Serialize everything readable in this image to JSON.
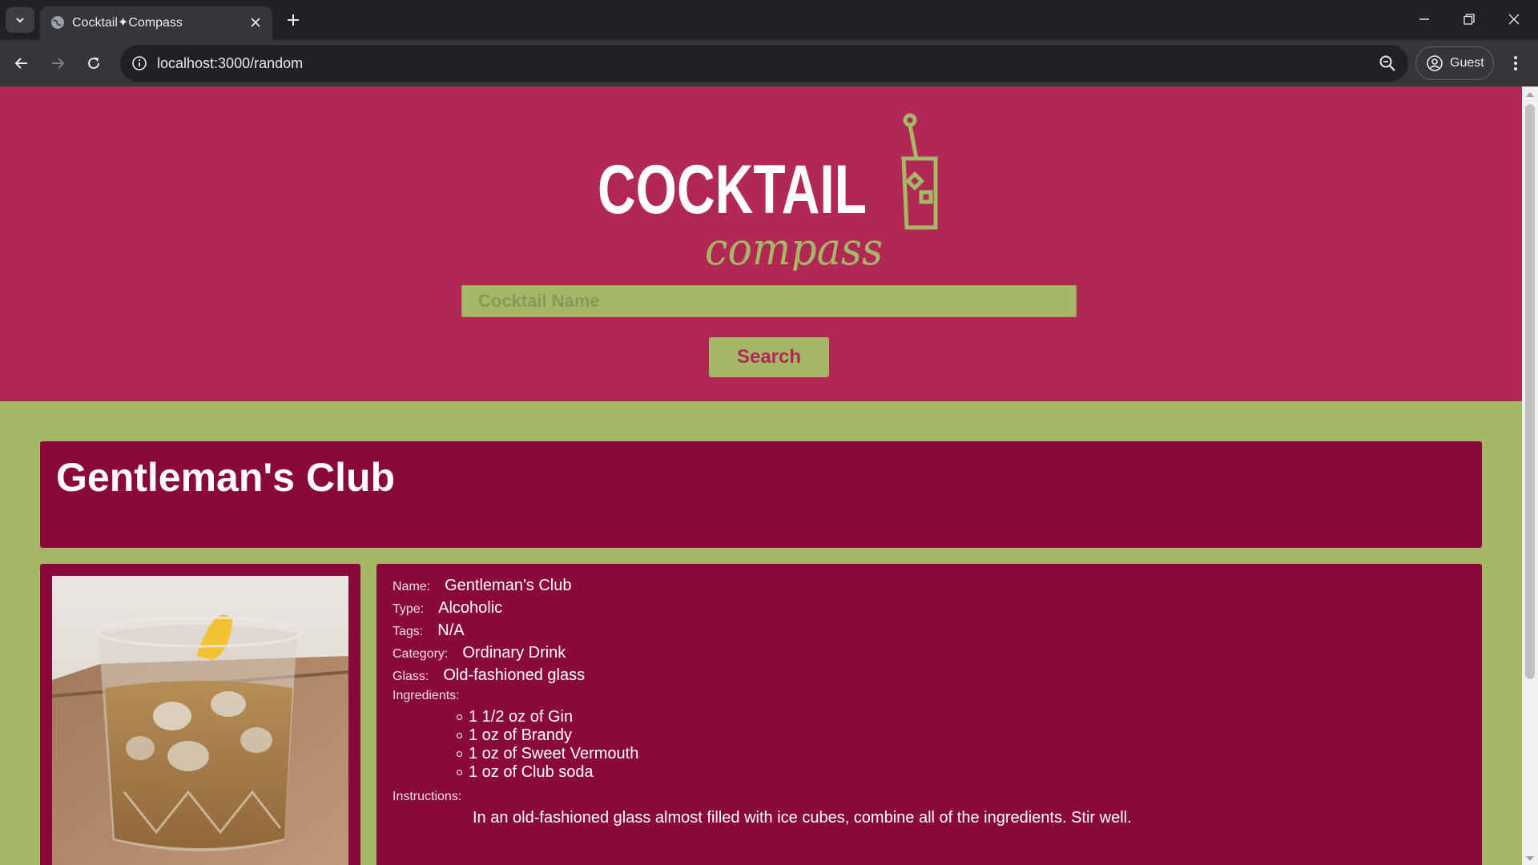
{
  "browser": {
    "tab": {
      "title": "Cocktail✦Compass"
    },
    "address_bar": {
      "url": "localhost:3000/random"
    },
    "profile": {
      "label": "Guest"
    }
  },
  "page": {
    "logo": {
      "word": "COCKTAIL",
      "script": "compass"
    },
    "search": {
      "placeholder": "Cocktail Name",
      "value": "",
      "button_label": "Search"
    },
    "drink": {
      "title": "Gentleman's Club",
      "fields": {
        "name": {
          "label": "Name:",
          "value": "Gentleman's Club"
        },
        "type": {
          "label": "Type:",
          "value": "Alcoholic"
        },
        "tags": {
          "label": "Tags:",
          "value": "N/A"
        },
        "category": {
          "label": "Category:",
          "value": "Ordinary Drink"
        },
        "glass": {
          "label": "Glass:",
          "value": "Old-fashioned glass"
        }
      },
      "ingredients_label": "Ingredients:",
      "ingredients": [
        "1 1/2 oz of Gin",
        "1 oz of Brandy",
        "1 oz of Sweet Vermouth",
        "1 oz of Club soda"
      ],
      "instructions_label": "Instructions:",
      "instructions": "In an old-fashioned glass almost filled with ice cubes, combine all of the ingredients. Stir well."
    }
  },
  "colors": {
    "header_bg": "#b22756",
    "page_bg": "#a5b865",
    "card_bg": "#89093a",
    "accent_green": "#a5b865"
  },
  "icons": [
    "tab-search-icon",
    "globe-icon",
    "close-icon",
    "plus-icon",
    "minimize-icon",
    "restore-icon",
    "window-close-icon",
    "back-icon",
    "forward-icon",
    "reload-icon",
    "info-icon",
    "zoom-icon",
    "guest-avatar-icon",
    "kebab-menu-icon",
    "cocktail-glass-icon"
  ]
}
